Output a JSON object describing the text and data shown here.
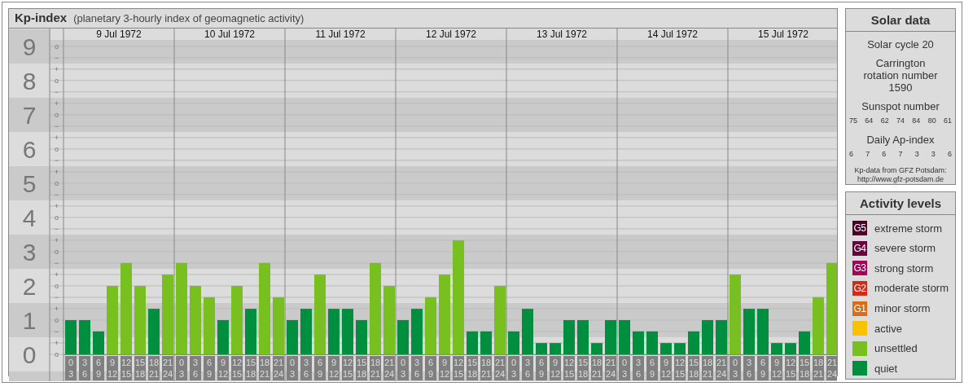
{
  "kp_panel": {
    "title": "Kp-index",
    "subtitle": "(planetary 3-hourly index of geomagnetic activity)",
    "days": [
      "9 Jul 1972",
      "10 Jul 1972",
      "11 Jul 1972",
      "12 Jul 1972",
      "13 Jul 1972",
      "14 Jul 1972",
      "15 Jul 1972"
    ],
    "sublevel_labels": [
      "o",
      "−",
      "+",
      "o",
      "−",
      "+",
      "o",
      "−",
      "+",
      "o",
      "−",
      "+",
      "o",
      "−",
      "+",
      "o",
      "−",
      "+",
      "o",
      "−",
      "+",
      "o",
      "−",
      "+",
      "o",
      "−",
      "+",
      "o"
    ],
    "chart_data": {
      "type": "bar",
      "grid": true,
      "ylim": [
        0,
        9.52
      ],
      "yticks": [
        {
          "value": 0,
          "label": "0"
        },
        {
          "value": 1,
          "label": "1"
        },
        {
          "value": 2,
          "label": "2"
        },
        {
          "value": 3,
          "label": "3"
        },
        {
          "value": 4,
          "label": "4"
        },
        {
          "value": 5,
          "label": "5"
        },
        {
          "value": 6,
          "label": "6"
        },
        {
          "value": 7,
          "label": "7"
        },
        {
          "value": 8,
          "label": "8"
        },
        {
          "value": 9,
          "label": "9"
        }
      ],
      "categories": [
        "0\n3",
        "3\n6",
        "6\n9",
        "9\n12",
        "12\n15",
        "15\n18",
        "18\n21",
        "21\n24",
        "0\n3",
        "3\n6",
        "6\n9",
        "9\n12",
        "12\n15",
        "15\n18",
        "18\n21",
        "21\n24",
        "0\n3",
        "3\n6",
        "6\n9",
        "9\n12",
        "12\n15",
        "15\n18",
        "18\n21",
        "21\n24",
        "0\n3",
        "3\n6",
        "6\n9",
        "9\n12",
        "12\n15",
        "15\n18",
        "18\n21",
        "21\n24",
        "0\n3",
        "3\n6",
        "6\n9",
        "9\n12",
        "12\n15",
        "15\n18",
        "18\n21",
        "21\n24",
        "0\n3",
        "3\n6",
        "6\n9",
        "9\n12",
        "12\n15",
        "15\n18",
        "18\n21",
        "21\n24",
        "0\n3",
        "3\n6",
        "6\n9",
        "9\n12",
        "12\n15",
        "15\n18",
        "18\n21",
        "21\n24"
      ],
      "series": [
        {
          "color": "#008f3e",
          "values": [
            1,
            1,
            0.67,
            null,
            null,
            null,
            1.33,
            null,
            null,
            null,
            null,
            1,
            null,
            1.33,
            null,
            null,
            1,
            1.33,
            null,
            1.33,
            1.33,
            1,
            null,
            null,
            1,
            1.33,
            null,
            null,
            null,
            0.67,
            0.67,
            null,
            0.67,
            1.33,
            0.33,
            0.33,
            1,
            1,
            0.33,
            1,
            1,
            0.67,
            0.67,
            0.33,
            0.33,
            0.67,
            1,
            1,
            null,
            1.33,
            1.33,
            0.33,
            0.33,
            0.67,
            null,
            null
          ]
        },
        {
          "color": "#78bf20",
          "values": [
            null,
            null,
            null,
            2,
            2.67,
            2,
            null,
            2.33,
            2.67,
            2,
            1.67,
            null,
            2,
            null,
            2.67,
            1.67,
            null,
            null,
            2.33,
            null,
            null,
            null,
            2.67,
            2,
            null,
            null,
            1.67,
            2.33,
            3.33,
            null,
            null,
            2,
            null,
            null,
            null,
            null,
            null,
            null,
            null,
            null,
            null,
            null,
            null,
            null,
            null,
            null,
            null,
            null,
            2.33,
            null,
            null,
            null,
            null,
            null,
            1.67,
            2.67
          ]
        }
      ]
    }
  },
  "solar_data": {
    "title": "Solar data",
    "solar_cycle": "Solar cycle 20",
    "carrington": "Carrington rotation number 1590",
    "sunspot_title": "Sunspot number",
    "sunspot_numbers": [
      "75",
      "64",
      "62",
      "74",
      "84",
      "80",
      "61"
    ],
    "ap_title": "Daily Ap-index",
    "ap_values": [
      "6",
      "7",
      "6",
      "7",
      "3",
      "3",
      "6"
    ],
    "source": "Kp-data from GFZ Potsdam: http://www.gfz-potsdam.de"
  },
  "activity_levels": {
    "title": "Activity levels",
    "items": [
      {
        "code": "G5",
        "label": "extreme storm",
        "color": "#4a0027"
      },
      {
        "code": "G4",
        "label": "severe storm",
        "color": "#6b0040"
      },
      {
        "code": "G3",
        "label": "strong storm",
        "color": "#a8005a"
      },
      {
        "code": "G2",
        "label": "moderate storm",
        "color": "#d42a16"
      },
      {
        "code": "G1",
        "label": "minor storm",
        "color": "#e06c12"
      },
      {
        "label": "active",
        "color": "#f9c200"
      },
      {
        "label": "unsettled",
        "color": "#78bf20"
      },
      {
        "label": "quiet",
        "color": "#008f3e"
      }
    ]
  }
}
